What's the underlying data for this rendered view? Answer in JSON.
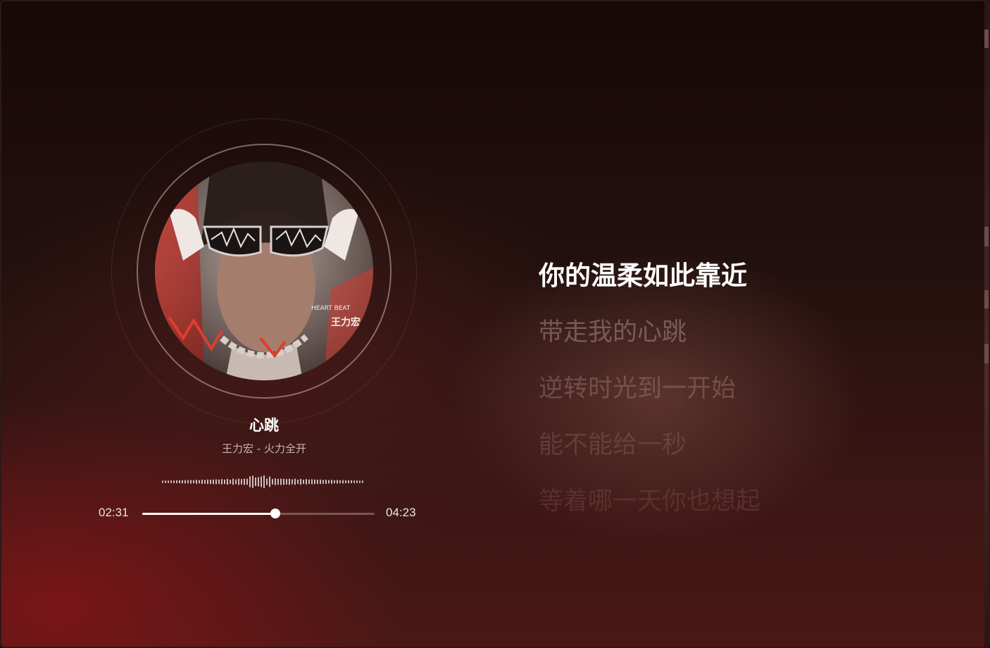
{
  "song": {
    "title": "心跳",
    "subtitle": "王力宏 - 火力全开"
  },
  "album_art": {
    "caption": "王力宏",
    "header": "HEART BEAT"
  },
  "playback": {
    "current_time": "02:31",
    "total_time": "04:23",
    "progress": 0.574
  },
  "lyrics": [
    "你的温柔如此靠近",
    "带走我的心跳",
    "逆转时光到一开始",
    "能不能给一秒",
    "等着哪一天你也想起"
  ],
  "colors": {
    "accent": "#ffffff",
    "track": "#7b5754",
    "background": "#22100e"
  }
}
